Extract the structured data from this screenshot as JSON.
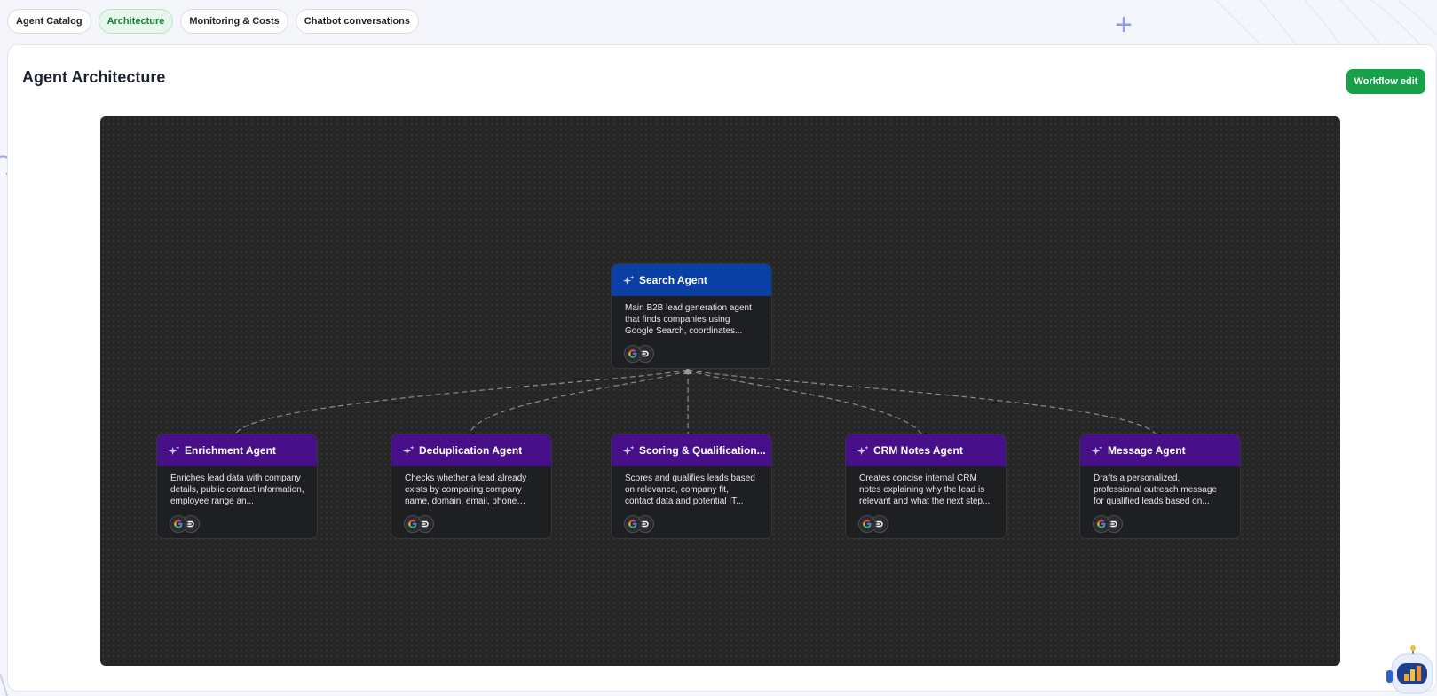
{
  "tabs": [
    {
      "label": "Agent Catalog",
      "active": false
    },
    {
      "label": "Architecture",
      "active": true
    },
    {
      "label": "Monitoring & Costs",
      "active": false
    },
    {
      "label": "Chatbot conversations",
      "active": false
    }
  ],
  "page": {
    "title": "Agent Architecture",
    "workflow_edit_label": "Workflow edit"
  },
  "colors": {
    "accent_green": "#17a24a",
    "root_header": "#0a40a6",
    "child_header": "#47108a",
    "canvas": "#262626"
  },
  "agents": {
    "root": {
      "name": "Search Agent",
      "description": "Main B2B lead generation agent that finds companies using Google Search, coordinates...",
      "tools": [
        "google-icon",
        "loop-icon"
      ]
    },
    "children": [
      {
        "name": "Enrichment Agent",
        "description": "Enriches lead data with company details, public contact information, employee range an...",
        "tools": [
          "google-icon",
          "loop-icon"
        ]
      },
      {
        "name": "Deduplication Agent",
        "description": "Checks whether a lead already exists by comparing company name, domain, email, phone and...",
        "tools": [
          "google-icon",
          "loop-icon"
        ]
      },
      {
        "name": "Scoring & Qualification...",
        "description": "Scores and qualifies leads based on relevance, company fit, contact data and potential IT...",
        "tools": [
          "google-icon",
          "loop-icon"
        ]
      },
      {
        "name": "CRM Notes Agent",
        "description": "Creates concise internal CRM notes explaining why the lead is relevant and what the next step...",
        "tools": [
          "google-icon",
          "loop-icon"
        ]
      },
      {
        "name": "Message Agent",
        "description": "Drafts a personalized, professional outreach message for qualified leads based on...",
        "tools": [
          "google-icon",
          "loop-icon"
        ]
      }
    ]
  }
}
